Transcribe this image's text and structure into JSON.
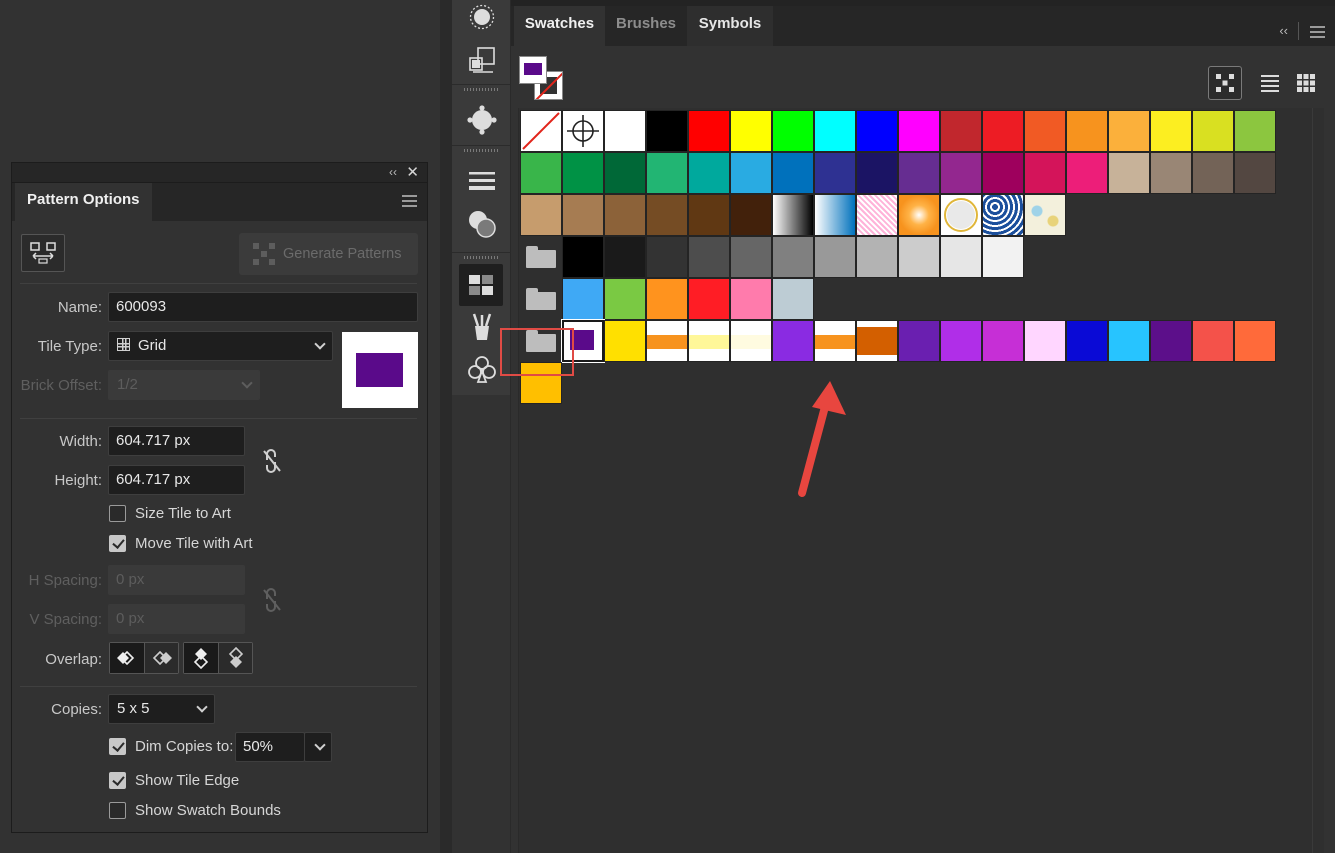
{
  "pattern_options": {
    "tab_label": "Pattern Options",
    "collapse_glyph": "‹‹",
    "close_glyph": "✕",
    "generate_label": "Generate Patterns",
    "name_label": "Name:",
    "name_value": "600093",
    "tile_type_label": "Tile Type:",
    "tile_type_value": "Grid",
    "brick_offset_label": "Brick Offset:",
    "brick_offset_value": "1/2",
    "width_label": "Width:",
    "width_value": "604.717 px",
    "height_label": "Height:",
    "height_value": "604.717 px",
    "size_tile_label": "Size Tile to Art",
    "size_tile_checked": false,
    "move_tile_label": "Move Tile with Art",
    "move_tile_checked": true,
    "h_spacing_label": "H Spacing:",
    "h_spacing_value": "0 px",
    "v_spacing_label": "V Spacing:",
    "v_spacing_value": "0 px",
    "overlap_label": "Overlap:",
    "copies_label": "Copies:",
    "copies_value": "5 x 5",
    "dim_copies_label": "Dim Copies to:",
    "dim_copies_checked": true,
    "dim_copies_value": "50%",
    "show_tile_edge_label": "Show Tile Edge",
    "show_tile_edge_checked": true,
    "show_swatch_bounds_label": "Show Swatch Bounds",
    "show_swatch_bounds_checked": false,
    "preview_color": "#5a0a8a"
  },
  "dock": {
    "icons": [
      "sun-icon",
      "transform-icon",
      "color-guide-icon",
      "stroke-icon",
      "transparency-icon",
      "swatches-icon",
      "brushes-icon",
      "symbols-icon"
    ]
  },
  "swatches_panel": {
    "tabs": [
      "Swatches",
      "Brushes",
      "Symbols"
    ],
    "active_tab": "Swatches",
    "collapse_glyph": "‹‹",
    "fill_color": "#5a0a8a",
    "rows": [
      [
        "none",
        "registration",
        "#ffffff",
        "#000000",
        "#ff0000",
        "#ffff00",
        "#00ff00",
        "#00ffff",
        "#0000ff",
        "#ff00ff",
        "#c1272d",
        "#ed1c24",
        "#f15a24",
        "#f7931e",
        "#fbb03b",
        "#fcee21",
        "#d9e021",
        "#8cc63f"
      ],
      [
        "#39b54a",
        "#009245",
        "#006837",
        "#22b573",
        "#00a99d",
        "#29abe2",
        "#0071bc",
        "#2e3192",
        "#1b1464",
        "#662d91",
        "#93278f",
        "#9e005d",
        "#d4145a",
        "#ed1e79",
        "#c7b299",
        "#998675",
        "#736357",
        "#534741"
      ],
      [
        "#c69c6d",
        "#a67c52",
        "#8c6239",
        "#754c24",
        "#603813",
        "#42210b",
        "gradient-black",
        "gradient-blue",
        "pattern-pink",
        "gradient-orange",
        "pattern-dots",
        "pattern-blue-swirl",
        "pattern-floral"
      ],
      [
        "folder",
        "#000000",
        "#1a1a1a",
        "#333333",
        "#4d4d4d",
        "#666666",
        "#808080",
        "#999999",
        "#b3b3b3",
        "#cccccc",
        "#e6e6e6",
        "#f2f2f2"
      ],
      [
        "folder",
        "#3fa9f5",
        "#7ac943",
        "#ff931e",
        "#ff1d25",
        "#ff7bac",
        "#bdccd4"
      ],
      [
        "folder",
        "selected-purple",
        "#ffe000",
        "stripe-orange",
        "stripe-yellow",
        "stripe-cream",
        "#8a2be2",
        "stripe-orange-mid",
        "stripe-brown",
        "#6a1fb0",
        "#b02ee8",
        "#c62fd6",
        "#ffd6ff",
        "#0a0ad6",
        "#27c4ff",
        "#5c0f8a",
        "#f4524a",
        "#ff6a3a"
      ],
      [
        "#ffbf00"
      ]
    ]
  }
}
